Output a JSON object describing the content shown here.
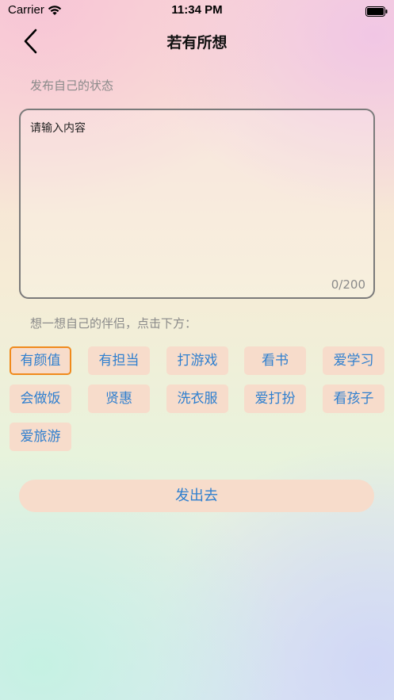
{
  "status_bar": {
    "carrier": "Carrier",
    "time": "11:34 PM"
  },
  "nav": {
    "title": "若有所想",
    "back_icon": "chevron-left-icon"
  },
  "post": {
    "label": "发布自己的状态",
    "placeholder": "请输入内容",
    "value": "",
    "counter": "0/200"
  },
  "partner": {
    "label": "想一想自己的伴侣，点击下方：",
    "tags": [
      {
        "label": "有颜值",
        "selected": true
      },
      {
        "label": "有担当",
        "selected": false
      },
      {
        "label": "打游戏",
        "selected": false
      },
      {
        "label": "看书",
        "selected": false
      },
      {
        "label": "爱学习",
        "selected": false
      },
      {
        "label": "会做饭",
        "selected": false
      },
      {
        "label": "贤惠",
        "selected": false
      },
      {
        "label": "洗衣服",
        "selected": false
      },
      {
        "label": "爱打扮",
        "selected": false
      },
      {
        "label": "看孩子",
        "selected": false
      },
      {
        "label": "爱旅游",
        "selected": false
      }
    ]
  },
  "send_label": "发出去",
  "colors": {
    "accent_text": "#2f7fcf",
    "tag_background": "#f7dccb",
    "selected_border": "#f08a1c"
  }
}
